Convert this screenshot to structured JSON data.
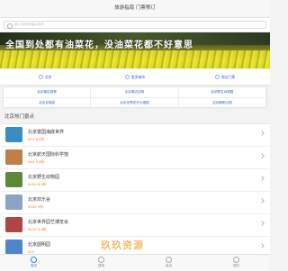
{
  "header": {
    "title": "旅游指南 门票预订"
  },
  "search": {
    "placeholder": "输入目的地/景点名称"
  },
  "banner": {
    "caption": "全国到处都有油菜花，没油菜花都不好意思"
  },
  "categories": [
    {
      "label": "北京",
      "icon": "location-icon"
    },
    {
      "label": "更多城市",
      "icon": "city-icon"
    },
    {
      "label": "周边门票",
      "icon": "ticket-icon"
    }
  ],
  "quick_links": [
    "北京景区推荐",
    "北京周边自驾",
    "北京野生动物园",
    "北京自驾游",
    "北京世界花卉大观园",
    "北京朝阳公园"
  ],
  "section": {
    "title": "北京热门景点"
  },
  "attractions": [
    {
      "name": "北京富国海底世界",
      "price": "¥75 8.6折",
      "thumb": "#3a8cc2"
    },
    {
      "name": "北京航天国际科学馆",
      "price": "¥40 9.6折",
      "thumb": "#c07f4a"
    },
    {
      "name": "北京野生动物园",
      "price": "¥100 8.5折",
      "thumb": "#5c8a3a"
    },
    {
      "name": "北京欢乐谷",
      "price": "¥200 9折",
      "thumb": "#8aa4c8"
    },
    {
      "name": "北京世界园艺博览会",
      "price": "¥120 9.4折",
      "thumb": "#b04545"
    },
    {
      "name": "北京圆明园",
      "price": "¥25",
      "thumb": "#4f86c9"
    }
  ],
  "tabs": [
    {
      "label": "首页",
      "icon": "home-icon"
    },
    {
      "label": "搜索",
      "icon": "search-icon"
    },
    {
      "label": "身边",
      "icon": "nearby-icon"
    },
    {
      "label": "我的",
      "icon": "user-icon"
    }
  ],
  "watermark": "玖玖资源"
}
